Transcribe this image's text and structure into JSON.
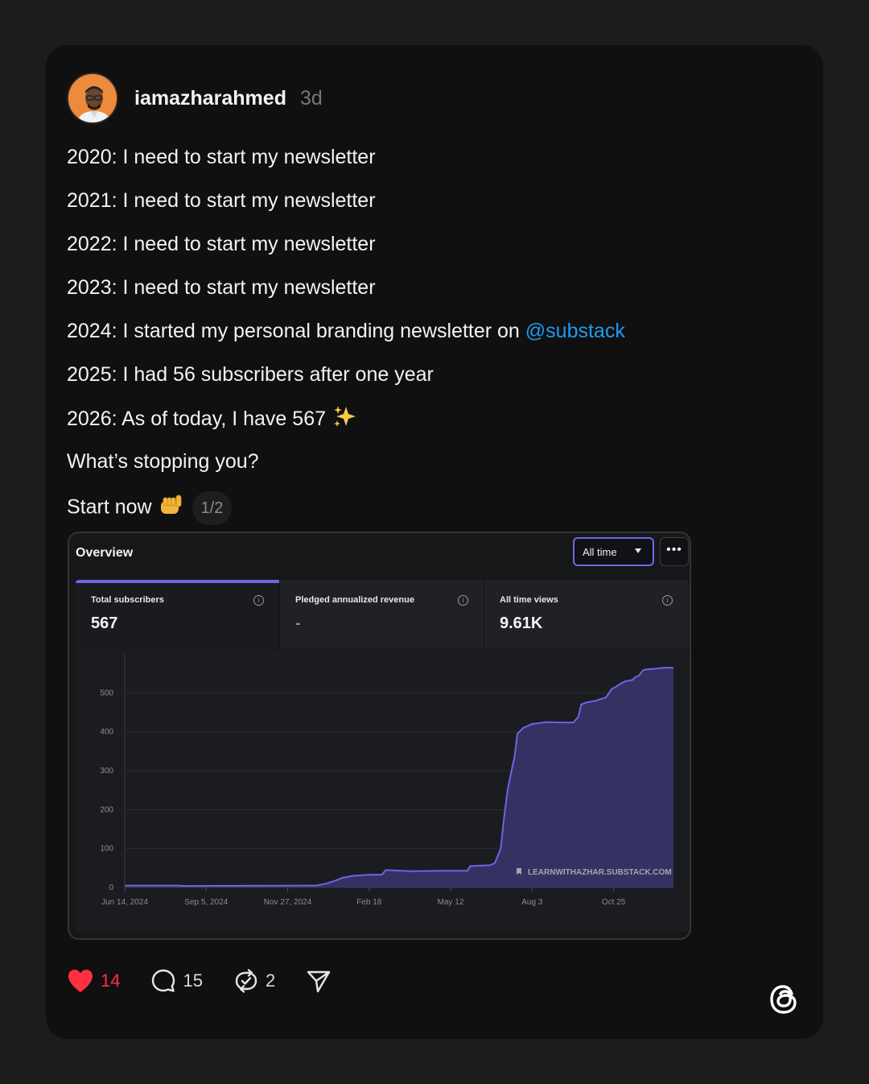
{
  "post": {
    "username": "iamazharahmed",
    "timestamp": "3d",
    "lines": {
      "l2020": "2020: I need to start my newsletter",
      "l2021": "2021: I need to start my newsletter",
      "l2022": "2022: I need to start my newsletter",
      "l2023": "2023: I need to start my newsletter",
      "l2024_text": "2024: I started my personal branding newsletter on ",
      "l2024_mention": "@substack",
      "l2025": "2025: I had 56 subscribers after one year",
      "l2026": "2026: As of today, I have 567",
      "l2026_emoji": "✨",
      "question": "What’s stopping you?",
      "cta": "Start now",
      "cta_emoji": "🫵"
    },
    "media_counter": "1/2"
  },
  "overview": {
    "title": "Overview",
    "range_select": "All time",
    "more_label": "•••",
    "stats": [
      {
        "label": "Total subscribers",
        "value": "567"
      },
      {
        "label": "Pledged annualized revenue",
        "value": "-"
      },
      {
        "label": "All time views",
        "value": "9.61K"
      }
    ],
    "info_glyph": "i",
    "watermark": "LEARNWITHAZHAR.SUBSTACK.COM"
  },
  "chart_data": {
    "type": "area",
    "title": "",
    "xlabel": "",
    "ylabel": "",
    "ylim": [
      0,
      600
    ],
    "y_ticks": [
      0,
      100,
      200,
      300,
      400,
      500
    ],
    "x_tick_labels": [
      "Jun 14, 2024",
      "Sep 5, 2024",
      "Nov 27, 2024",
      "Feb 18",
      "May 12",
      "Aug 3",
      "Oct 25"
    ],
    "x_range_days": [
      0,
      559
    ],
    "grid": true,
    "color": "#6d64e6",
    "fill": "#3a3570",
    "series": [
      {
        "x_days": [
          0,
          55,
          60,
          195,
          205,
          215,
          222,
          228,
          232,
          238,
          250,
          262,
          266,
          290,
          325,
          349,
          352,
          372,
          377,
          383,
          386,
          390,
          394,
          397,
          400,
          406,
          415,
          430,
          445,
          455,
          457,
          462,
          465,
          470,
          480,
          490,
          492,
          496,
          500,
          506,
          510,
          515,
          517,
          520,
          524,
          528,
          531,
          540,
          552,
          559
        ],
        "values": [
          5,
          5,
          4,
          5,
          10,
          18,
          25,
          28,
          30,
          31,
          33,
          33,
          45,
          42,
          43,
          43,
          55,
          57,
          63,
          100,
          170,
          250,
          300,
          335,
          395,
          410,
          420,
          425,
          424,
          424,
          424,
          438,
          470,
          475,
          480,
          488,
          495,
          510,
          515,
          525,
          530,
          532,
          533,
          540,
          545,
          558,
          560,
          562,
          565,
          564
        ]
      }
    ]
  },
  "actions": {
    "likes": "14",
    "replies": "15",
    "reposts": "2"
  }
}
